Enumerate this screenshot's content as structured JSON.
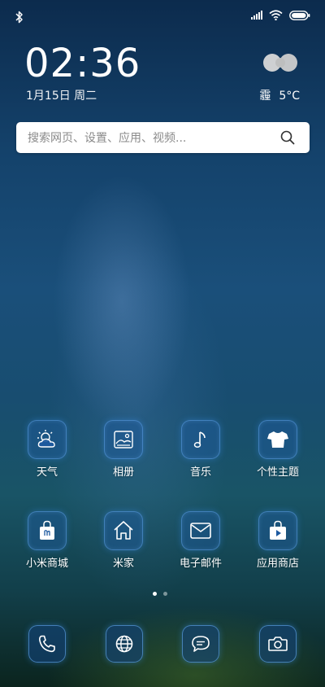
{
  "status_bar": {
    "icons": [
      "bluetooth-icon",
      "signal-icon",
      "wifi-icon",
      "battery-icon"
    ]
  },
  "clock": {
    "time": "02:36",
    "date": "1月15日 周二"
  },
  "weather": {
    "condition": "霾",
    "temperature": "5°C",
    "icon": "haze-icon"
  },
  "search": {
    "placeholder": "搜索网页、设置、应用、视频..."
  },
  "apps": [
    {
      "label": "天气",
      "icon": "weather-icon"
    },
    {
      "label": "相册",
      "icon": "gallery-icon"
    },
    {
      "label": "音乐",
      "icon": "music-icon"
    },
    {
      "label": "个性主题",
      "icon": "themes-icon"
    },
    {
      "label": "小米商城",
      "icon": "mi-store-icon"
    },
    {
      "label": "米家",
      "icon": "mi-home-icon"
    },
    {
      "label": "电子邮件",
      "icon": "email-icon"
    },
    {
      "label": "应用商店",
      "icon": "app-store-icon"
    }
  ],
  "pages": {
    "current": 1,
    "total": 2
  },
  "dock": [
    {
      "icon": "phone-icon"
    },
    {
      "icon": "browser-icon"
    },
    {
      "icon": "messages-icon"
    },
    {
      "icon": "camera-icon"
    }
  ]
}
